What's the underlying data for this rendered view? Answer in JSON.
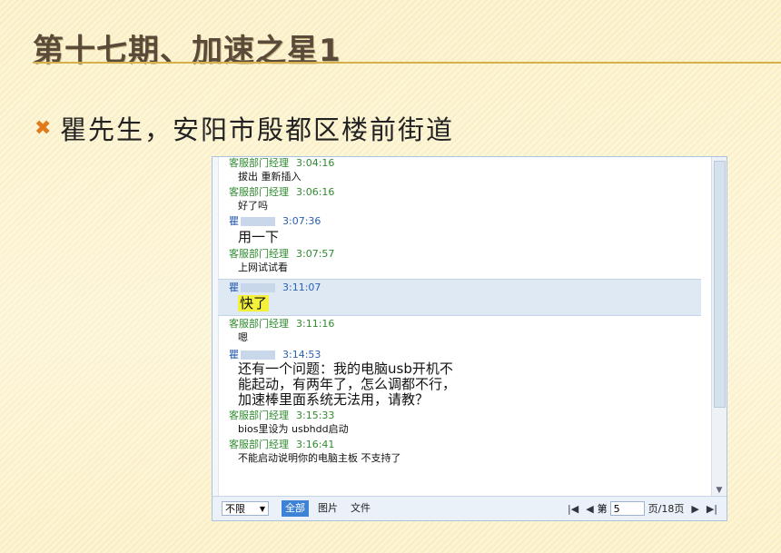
{
  "slide": {
    "title": "第十七期、加速之星1",
    "bullet": "瞿先生，安阳市殷都区楼前街道"
  },
  "chat": {
    "messages": [
      {
        "sender": "客服部门经理",
        "time": "3:04:16",
        "text": "拔出 重新插入",
        "type": "cs",
        "size": "small"
      },
      {
        "sender": "客服部门经理",
        "time": "3:06:16",
        "text": "好了吗",
        "type": "cs",
        "size": "small"
      },
      {
        "sender": "瞿",
        "time": "3:07:36",
        "text": "用一下",
        "type": "user",
        "size": "big"
      },
      {
        "sender": "客服部门经理",
        "time": "3:07:57",
        "text": "上网试试看",
        "type": "cs",
        "size": "small"
      },
      {
        "sender": "瞿",
        "time": "3:11:07",
        "text": "快了",
        "type": "user",
        "size": "big",
        "highlight": true
      },
      {
        "sender": "客服部门经理",
        "time": "3:11:16",
        "text": "嗯",
        "type": "cs",
        "size": "small"
      },
      {
        "sender": "瞿",
        "time": "3:14:53",
        "text_lines": [
          "还有一个问题：我的电脑usb开机不",
          "能起动，有两年了，怎么调都不行，",
          "加速棒里面系统无法用，请教？"
        ],
        "type": "user",
        "size": "big2"
      },
      {
        "sender": "客服部门经理",
        "time": "3:15:33",
        "text": "bios里设为 usbhdd启动",
        "type": "cs",
        "size": "small"
      },
      {
        "sender": "客服部门经理",
        "time": "3:16:41",
        "text": "不能启动说明你的电脑主板 不支持了",
        "type": "cs",
        "size": "small"
      }
    ],
    "toolbar": {
      "filter_value": "不限",
      "tabs": [
        "全部",
        "图片",
        "文件"
      ],
      "page_label": "第",
      "page_value": "5",
      "page_total": "页/18页"
    },
    "colors": {
      "cs_sender": "#2f8a2f",
      "user_sender": "#2b5fb3",
      "active_tab": "#3d82d6"
    }
  }
}
